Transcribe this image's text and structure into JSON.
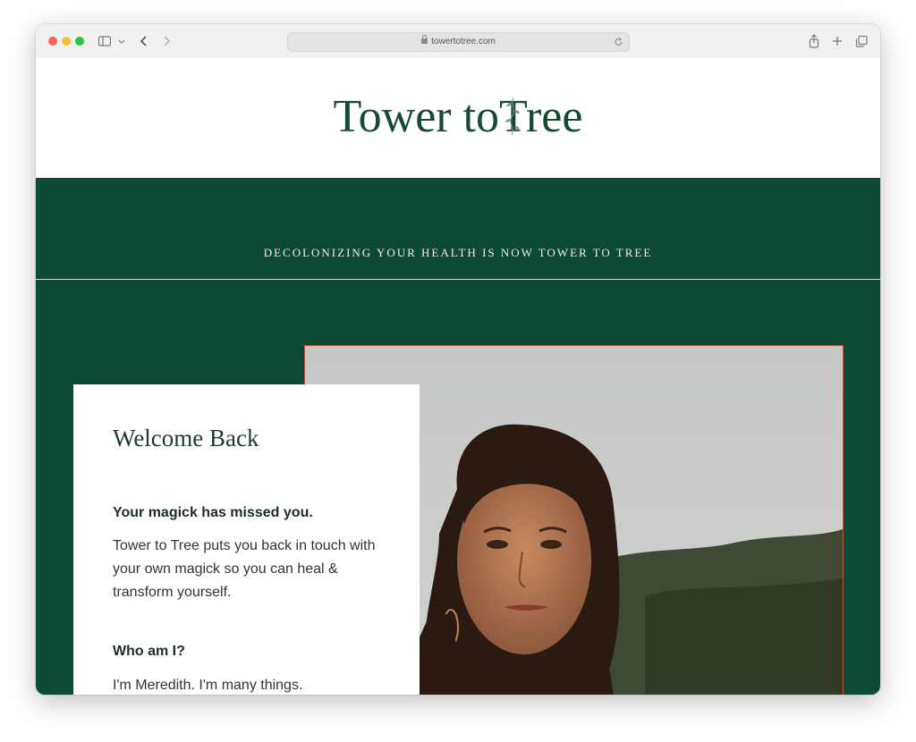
{
  "browser": {
    "url": "towertotree.com",
    "icons": [
      "sidebar-icon",
      "chevron-down-icon",
      "back-icon",
      "forward-icon",
      "lock-icon",
      "reload-icon",
      "share-icon",
      "new-tab-icon",
      "tabs-icon"
    ]
  },
  "site": {
    "logo_part1": "Tower to",
    "logo_part2": "Tree",
    "announcement": "DECOLONIZING YOUR HEALTH IS NOW TOWER TO TREE"
  },
  "welcome_card": {
    "title": "Welcome Back",
    "heading1": "Your magick has missed you.",
    "paragraph1": "Tower to Tree puts you back in touch with your own magick so you can heal & transform yourself.",
    "heading2": "Who am I?",
    "paragraph2": "I'm Meredith. I'm many things."
  },
  "colors": {
    "brand_green": "#0d4a36",
    "logo_green": "#174a33",
    "photo_border": "#c0553d"
  }
}
